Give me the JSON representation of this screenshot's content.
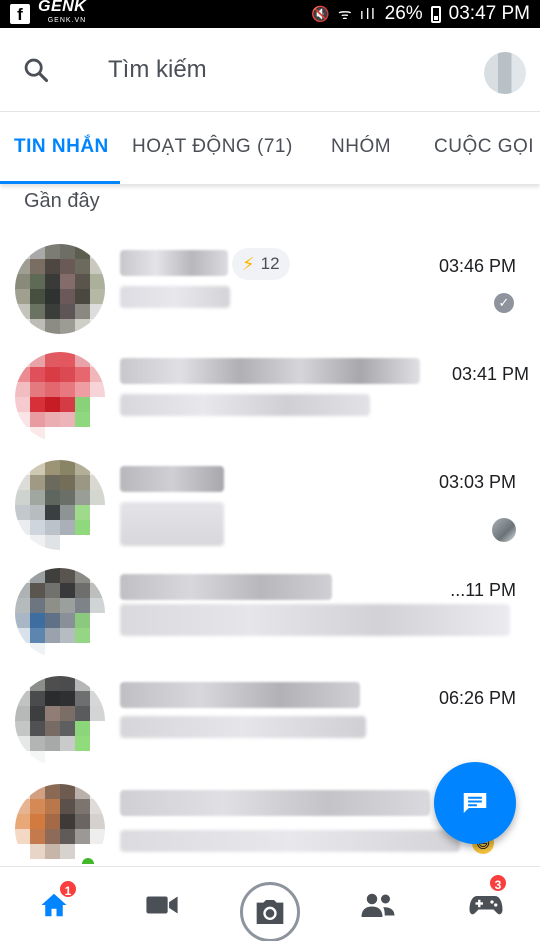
{
  "status_bar": {
    "app_icon": "facebook-icon",
    "watermark": "GENK",
    "watermark_sub": "GENK.VN",
    "icons": "mute-icon wifi-icon signal-icon",
    "battery": "26%",
    "time": "03:47 PM"
  },
  "search": {
    "placeholder": "Tìm kiếm",
    "icon": "search-icon"
  },
  "tabs": [
    {
      "label": "TIN NHẮN",
      "active": true
    },
    {
      "label": "HOẠT ĐỘNG (71)",
      "active": false
    },
    {
      "label": "NHÓM",
      "active": false
    },
    {
      "label": "CUỘC GỌI",
      "active": false
    }
  ],
  "section_title": "Gần đây",
  "conversations": [
    {
      "time": "03:46 PM",
      "badge_count": "12",
      "status": "seen-check"
    },
    {
      "time": "03:41 PM",
      "status": "none"
    },
    {
      "time": "03:03 PM",
      "status": "seen-avatar"
    },
    {
      "time": "...11 PM",
      "status": "none"
    },
    {
      "time": "06:26 PM",
      "status": "none"
    },
    {
      "time": "",
      "status": "emoji"
    }
  ],
  "bottom_nav": {
    "home_badge": "1",
    "games_badge": "3"
  },
  "colors": {
    "accent": "#0084ff",
    "badge": "#fa3e3e",
    "online": "#42b72a"
  }
}
